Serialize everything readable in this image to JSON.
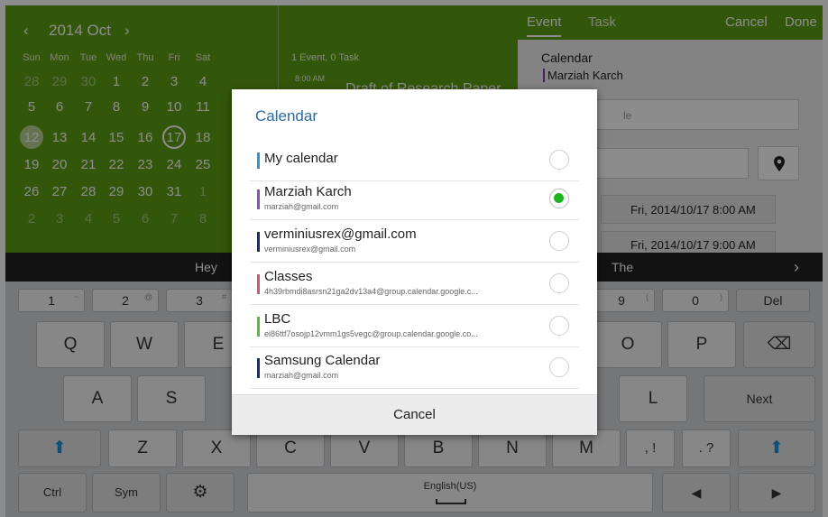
{
  "calendar_view": {
    "prev_icon": "‹",
    "month": "2014 Oct",
    "next_icon": "›",
    "weekdays": [
      "Sun",
      "Mon",
      "Tue",
      "Wed",
      "Thu",
      "Fri",
      "Sat"
    ],
    "weeks": [
      [
        "28",
        "29",
        "30",
        "1",
        "2",
        "3",
        "4"
      ],
      [
        "5",
        "6",
        "7",
        "8",
        "9",
        "10",
        "11"
      ],
      [
        "12",
        "13",
        "14",
        "15",
        "16",
        "17",
        "18"
      ],
      [
        "19",
        "20",
        "21",
        "22",
        "23",
        "24",
        "25"
      ],
      [
        "26",
        "27",
        "28",
        "29",
        "30",
        "31",
        "1"
      ],
      [
        "2",
        "3",
        "4",
        "5",
        "6",
        "7",
        "8"
      ]
    ],
    "today": "12",
    "selected": "17"
  },
  "event_list": {
    "count": "1 Event, 0 Task",
    "time": "8:00 AM",
    "title": "Draft of Research Paper"
  },
  "editor": {
    "tab_event": "Event",
    "tab_task": "Task",
    "cancel": "Cancel",
    "done": "Done",
    "calendar_label": "Calendar",
    "calendar_value": "Marziah Karch",
    "title_placeholder": "le",
    "from": "Fri, 2014/10/17  8:00 AM",
    "to": "Fri, 2014/10/17  9:00 AM"
  },
  "keyboard": {
    "suggestions": [
      "Hey",
      "The"
    ],
    "suggestion_arrow": "›",
    "row_numbers": [
      {
        "main": "1",
        "sup": "~"
      },
      {
        "main": "2",
        "sup": "@"
      },
      {
        "main": "3",
        "sup": "#"
      },
      {
        "main": "9",
        "sup": "("
      },
      {
        "main": "0",
        "sup": ")"
      }
    ],
    "del": "Del",
    "row_q": [
      "Q",
      "W",
      "E",
      "O",
      "P"
    ],
    "backspace_icon": "⌫",
    "row_a": [
      "A",
      "S",
      "L"
    ],
    "next": "Next",
    "shift_icon": "⬆",
    "row_z": [
      "Z",
      "X",
      "C",
      "V",
      "B",
      "N",
      "M"
    ],
    "punct_comma": ", !",
    "punct_period": ". ?",
    "ctrl": "Ctrl",
    "sym": "Sym",
    "settings_icon": "⚙",
    "space_label": "English(US)",
    "left_icon": "◀",
    "right_icon": "▶"
  },
  "dialog": {
    "title": "Calendar",
    "cancel": "Cancel",
    "calendars": [
      {
        "name": "My calendar",
        "email": "",
        "color": "#2f95d8",
        "selected": false
      },
      {
        "name": "Marziah Karch",
        "email": "marziah@gmail.com",
        "color": "#8a4fbf",
        "selected": true
      },
      {
        "name": "verminiusrex@gmail.com",
        "email": "verminiusrex@gmail.com",
        "color": "#1a2e6b",
        "selected": false
      },
      {
        "name": "Classes",
        "email": "4h39rbmdi8asrsn21ga2dv13a4@group.calendar.google.c...",
        "color": "#d8546c",
        "selected": false
      },
      {
        "name": "LBC",
        "email": "ei86ttf7osojp12vmm1gs5vegc@group.calendar.google.co...",
        "color": "#5dbb3a",
        "selected": false
      },
      {
        "name": "Samsung Calendar",
        "email": "marziah@gmail.com",
        "color": "#1a2e6b",
        "selected": false
      }
    ]
  }
}
